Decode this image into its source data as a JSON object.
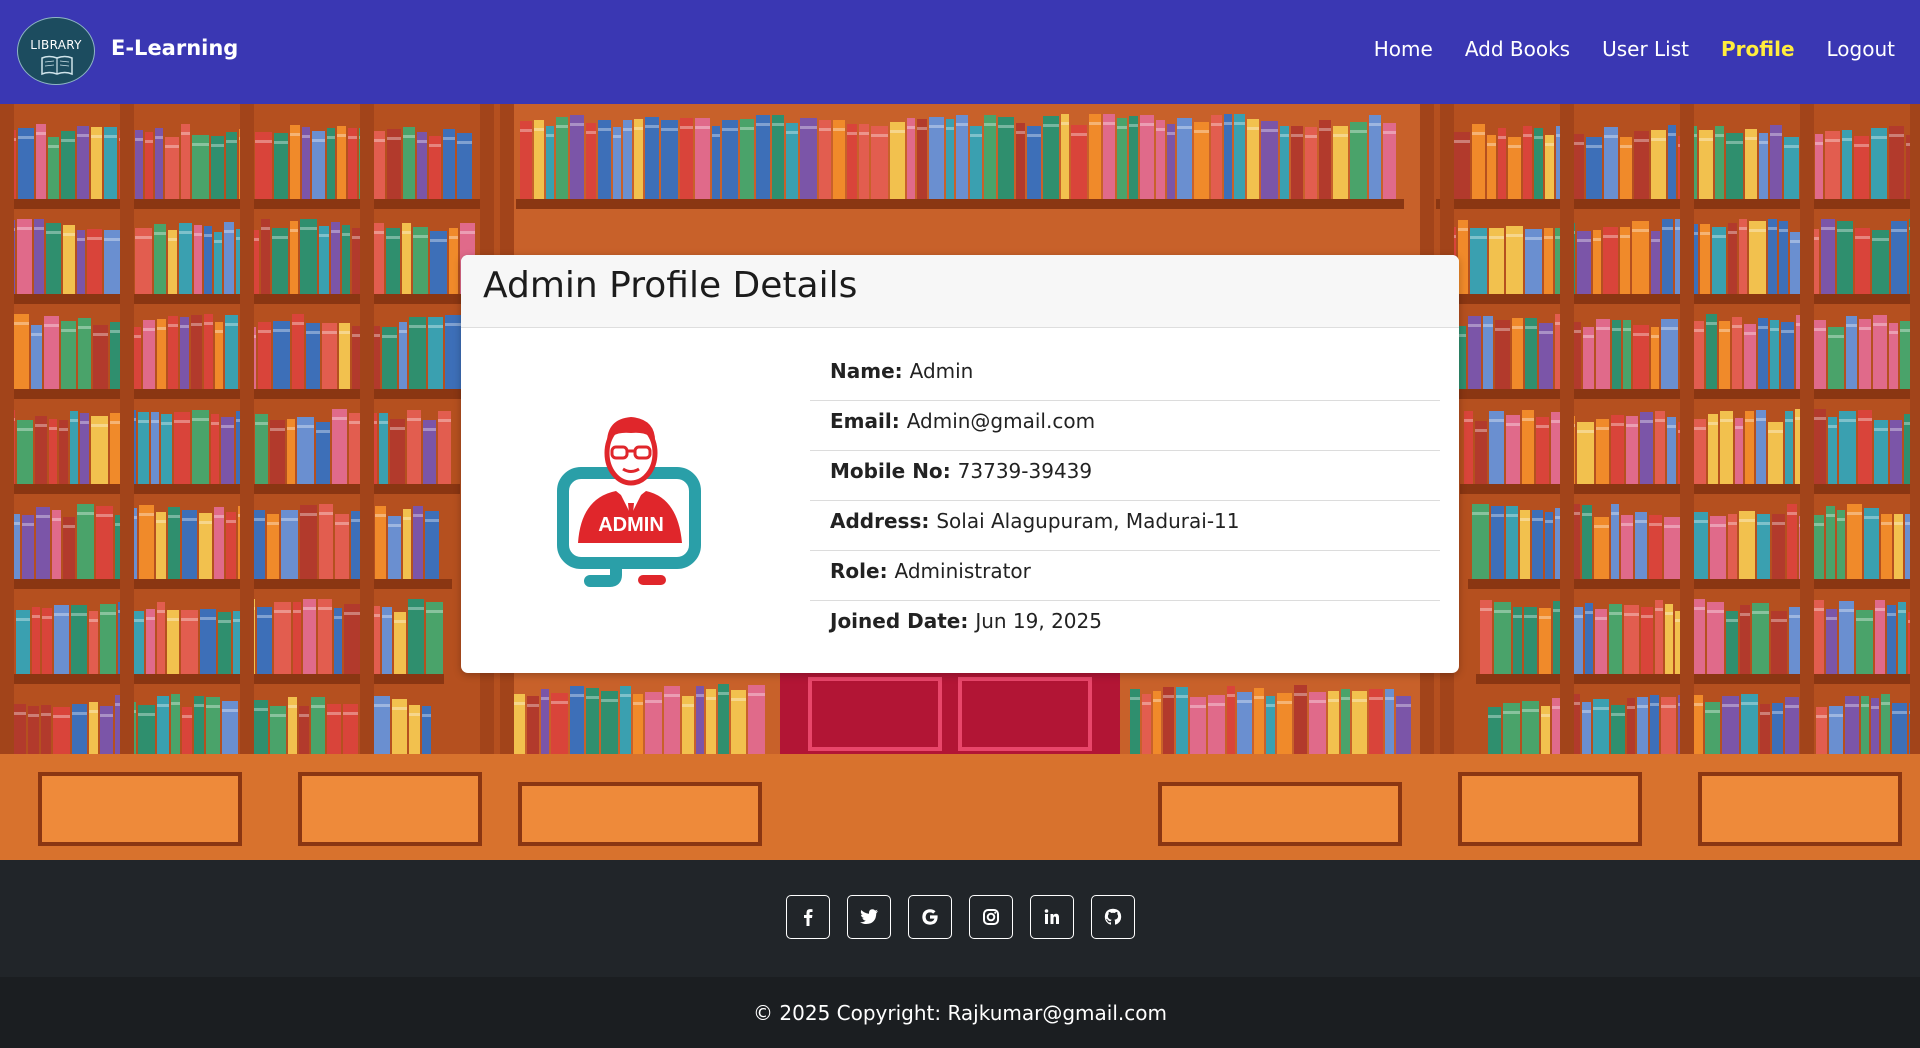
{
  "nav": {
    "logo_text": "LIBRARY",
    "brand": "E-Learning",
    "links": [
      {
        "label": "Home",
        "active": false
      },
      {
        "label": "Add Books",
        "active": false
      },
      {
        "label": "User List",
        "active": false
      },
      {
        "label": "Profile",
        "active": true
      },
      {
        "label": "Logout",
        "active": false
      }
    ]
  },
  "card": {
    "title": "Admin Profile Details",
    "avatar_label": "ADMIN",
    "details": [
      {
        "label": "Name",
        "value": "Admin"
      },
      {
        "label": "Email",
        "value": "Admin@gmail.com"
      },
      {
        "label": "Mobile No",
        "value": "73739-39439"
      },
      {
        "label": "Address",
        "value": "Solai Alagupuram, Madurai-11"
      },
      {
        "label": "Role",
        "value": "Administrator"
      },
      {
        "label": "Joined Date",
        "value": "Jun 19, 2025"
      }
    ]
  },
  "footer": {
    "social": [
      "facebook-icon",
      "twitter-icon",
      "google-icon",
      "instagram-icon",
      "linkedin-icon",
      "github-icon"
    ],
    "copyright": "© 2025 Copyright: Rajkumar@gmail.com"
  },
  "colors": {
    "navbar": "#3a37b3",
    "active_link": "#ffed3d",
    "footer": "#212529",
    "avatar_red": "#e0262b",
    "avatar_teal": "#2a9fa8"
  }
}
